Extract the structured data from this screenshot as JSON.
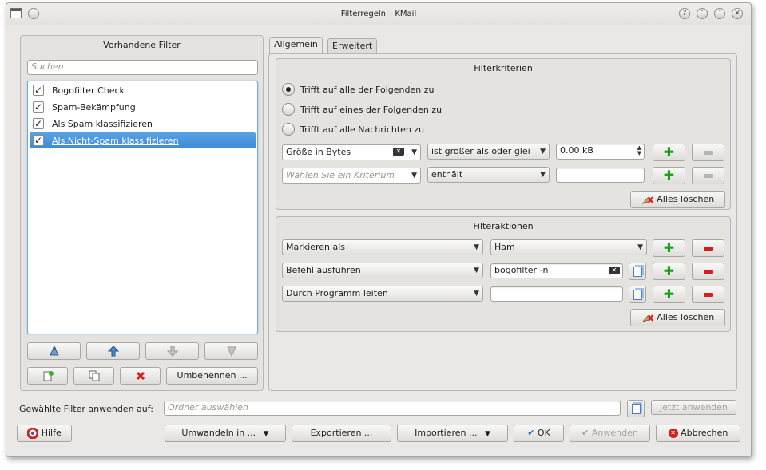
{
  "window": {
    "title": "Filterregeln – KMail",
    "help_glyph": "?",
    "minimize_glyph": "˅",
    "maximize_glyph": "˄",
    "close_glyph": "✕"
  },
  "left": {
    "title": "Vorhandene Filter",
    "search_placeholder": "Suchen",
    "filters": [
      {
        "label": "Bogofilter Check",
        "checked": true,
        "selected": false
      },
      {
        "label": "Spam-Bekämpfung",
        "checked": true,
        "selected": false
      },
      {
        "label": "Als Spam klassifizieren",
        "checked": true,
        "selected": false
      },
      {
        "label": "Als Nicht-Spam klassifizieren",
        "checked": true,
        "selected": true
      }
    ],
    "rename_label": "Umbenennen ...",
    "check_glyph": "✓"
  },
  "tabs": [
    {
      "label": "Allgemein",
      "active": true
    },
    {
      "label": "Erweitert",
      "active": false
    }
  ],
  "criteria": {
    "title": "Filterkriterien",
    "radios": [
      {
        "label": "Trifft auf alle der Folgenden zu",
        "checked": true
      },
      {
        "label": "Trifft auf eines der Folgenden zu",
        "checked": false
      },
      {
        "label": "Trifft auf alle Nachrichten zu",
        "checked": false
      }
    ],
    "rows": [
      {
        "field": "Größe in Bytes",
        "operator": "ist größer als oder glei",
        "value": "0.00 kB"
      },
      {
        "field_placeholder": "Wählen Sie ein Kriterium",
        "operator": "enthält",
        "value": ""
      }
    ],
    "clear_all": "Alles löschen"
  },
  "actions": {
    "title": "Filteraktionen",
    "rows": [
      {
        "action": "Markieren als",
        "value": "Ham"
      },
      {
        "action": "Befehl ausführen",
        "value": "bogofilter -n"
      },
      {
        "action": "Durch Programm leiten",
        "value": ""
      }
    ],
    "clear_all": "Alles löschen"
  },
  "apply": {
    "label": "Gewählte Filter anwenden auf:",
    "folder_placeholder": "Ordner auswählen",
    "apply_now": "Jetzt anwenden"
  },
  "bottom": {
    "help": "Hilfe",
    "convert": "Umwandeln in ...",
    "export": "Exportieren ...",
    "import": "Importieren ...",
    "ok": "OK",
    "apply": "Anwenden",
    "cancel": "Abbrechen"
  },
  "colors": {
    "selection": "#4a94dc",
    "add_green": "#1aa11a",
    "remove_red": "#d61e1e"
  }
}
